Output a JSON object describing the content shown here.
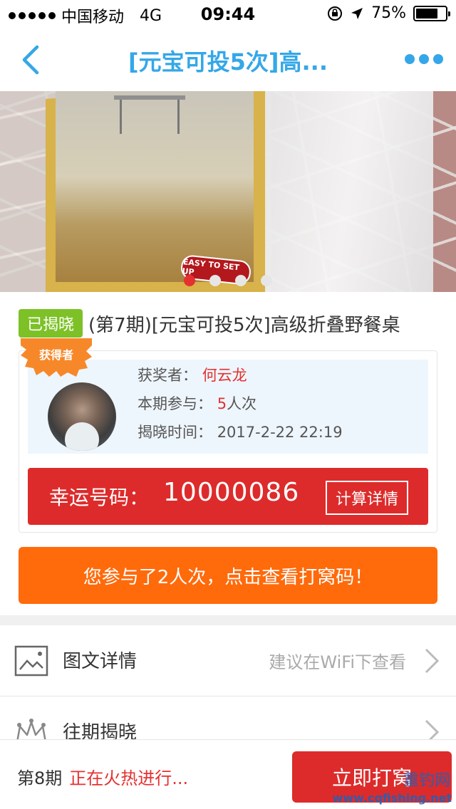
{
  "status_bar": {
    "carrier": "中国移动",
    "network": "4G",
    "time": "09:44",
    "battery": "75%",
    "battery_level": 0.75
  },
  "nav": {
    "title": "[元宝可投5次]高..."
  },
  "banner": {
    "badge_text": "EASY TO SET UP",
    "pages": 4,
    "active_page": 0
  },
  "product": {
    "status_tag": "已揭晓",
    "title": "(第7期)[元宝可投5次]高级折叠野餐桌",
    "winner_badge": "获得者",
    "winner_label": "获奖者：",
    "winner_name": "何云龙",
    "participation_label": "本期参与：",
    "participation_count": "5",
    "participation_unit": "人次",
    "reveal_label": "揭晓时间：",
    "reveal_time": "2017-2-22 22:19",
    "lucky_label": "幸运号码：",
    "lucky_number": "10000086",
    "calc_button": "计算详情",
    "join_button": "您参与了2人次，点击查看打窝码！"
  },
  "list": [
    {
      "label": "图文详情",
      "hint": "建议在WiFi下查看",
      "icon": "image-icon"
    },
    {
      "label": "往期揭晓",
      "hint": "",
      "icon": "crown-icon"
    }
  ],
  "bottom": {
    "issue": "第8期",
    "status": "正在火热进行...",
    "button": "立即打窝"
  },
  "watermark": {
    "text": "www.cqfishing.net",
    "brand": "重钓网"
  },
  "colors": {
    "accent_blue": "#35a7e8",
    "red": "#dd2b2b",
    "orange": "#ff6a0b",
    "green": "#7dc127"
  }
}
